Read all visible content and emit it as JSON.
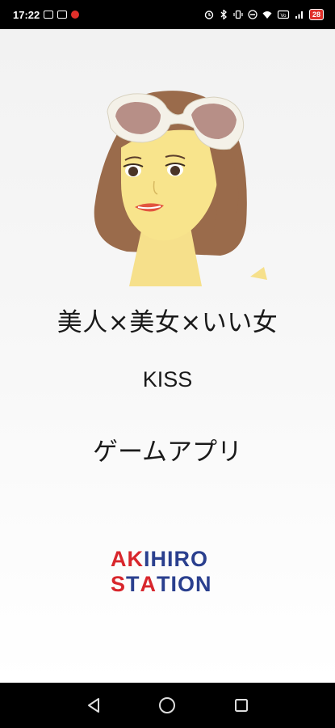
{
  "status_bar": {
    "time": "17:22",
    "battery": "28",
    "icons": [
      "image-icon",
      "notification-icon",
      "red-dot-icon",
      "alarm-icon",
      "bluetooth-icon",
      "vibrate-icon",
      "dnd-icon",
      "wifi-icon",
      "volte-icon",
      "signal-icon",
      "battery-icon"
    ]
  },
  "splash": {
    "line1": "美人×美女×いい女",
    "line2": "KISS",
    "line3": "ゲームアプリ"
  },
  "logo": {
    "row1": "AKIHIRO",
    "row2": "STATION",
    "colors": {
      "red": "#d8262c",
      "blue": "#2a3f8e"
    }
  },
  "nav": {
    "icons": [
      "back-icon",
      "home-icon",
      "recents-icon"
    ]
  }
}
